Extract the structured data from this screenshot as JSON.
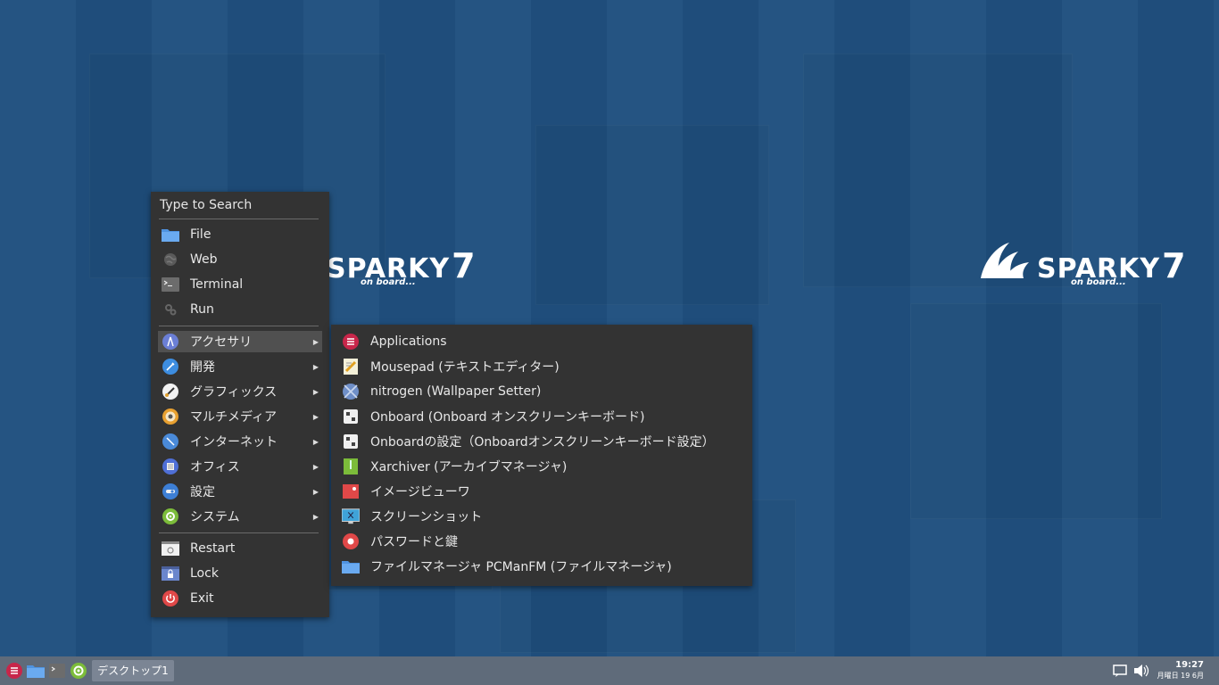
{
  "desktop": {
    "logo_word": "SPARKY",
    "logo_number": "7",
    "logo_tagline": "on board..."
  },
  "menu": {
    "search_label": "Type to Search",
    "quick_items": [
      {
        "label": "File",
        "icon": "folder-icon"
      },
      {
        "label": "Web",
        "icon": "globe-icon"
      },
      {
        "label": "Terminal",
        "icon": "terminal-icon"
      },
      {
        "label": "Run",
        "icon": "gears-icon"
      }
    ],
    "categories": [
      {
        "label": "アクセサリ",
        "icon": "accessories-icon"
      },
      {
        "label": "開発",
        "icon": "development-icon"
      },
      {
        "label": "グラフィックス",
        "icon": "graphics-icon"
      },
      {
        "label": "マルチメディア",
        "icon": "multimedia-icon"
      },
      {
        "label": "インターネット",
        "icon": "internet-icon"
      },
      {
        "label": "オフィス",
        "icon": "office-icon"
      },
      {
        "label": "設定",
        "icon": "settings-icon"
      },
      {
        "label": "システム",
        "icon": "system-icon"
      }
    ],
    "session_items": [
      {
        "label": "Restart",
        "icon": "restart-icon"
      },
      {
        "label": "Lock",
        "icon": "lock-icon"
      },
      {
        "label": "Exit",
        "icon": "power-icon"
      }
    ]
  },
  "submenu": {
    "items": [
      {
        "label": "Applications",
        "icon": "applications-icon"
      },
      {
        "label": "Mousepad (テキストエディター)",
        "icon": "text-editor-icon"
      },
      {
        "label": "nitrogen (Wallpaper Setter)",
        "icon": "nitrogen-icon"
      },
      {
        "label": "Onboard (Onboard オンスクリーンキーボード)",
        "icon": "keyboard-icon"
      },
      {
        "label": "Onboardの設定（Onboardオンスクリーンキーボード設定）",
        "icon": "keyboard-settings-icon"
      },
      {
        "label": "Xarchiver (アーカイブマネージャ)",
        "icon": "archive-icon"
      },
      {
        "label": "イメージビューワ",
        "icon": "image-viewer-icon"
      },
      {
        "label": "スクリーンショット",
        "icon": "screenshot-icon"
      },
      {
        "label": "パスワードと鍵",
        "icon": "password-keys-icon"
      },
      {
        "label": "ファイルマネージャ PCManFM (ファイルマネージャ)",
        "icon": "file-manager-icon"
      }
    ]
  },
  "taskbar": {
    "task_label": "デスクトップ1",
    "clock_time": "19:27",
    "clock_date": "月曜日 19 6月"
  },
  "colors": {
    "desktop_bg": "#20507f",
    "menu_bg": "#333333",
    "taskbar_bg": "#5f6b7a",
    "active_item": "#505050"
  }
}
